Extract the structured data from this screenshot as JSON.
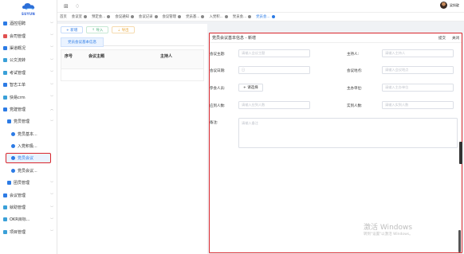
{
  "logo": {
    "text": "SUYUN"
  },
  "sidebar": {
    "items": [
      {
        "label": "酒控招聘",
        "color": "#2c7be5",
        "level": 0
      },
      {
        "label": "会司管理",
        "color": "#e05050",
        "level": 0
      },
      {
        "label": "渠道概况",
        "color": "#2c7be5",
        "level": 0
      },
      {
        "label": "公文流转",
        "color": "#3aa0d8",
        "level": 0
      },
      {
        "label": "考试管理",
        "color": "#3aa0d8",
        "level": 0
      },
      {
        "label": "智志工单",
        "color": "#2c7be5",
        "level": 0
      },
      {
        "label": "快易crm",
        "color": "#3aa0d8",
        "level": 0
      },
      {
        "label": "党建管理",
        "color": "#2c7be5",
        "level": 0
      },
      {
        "label": "党员管理",
        "color": "#2c7be5",
        "level": 1
      },
      {
        "label": "党员基本...",
        "color": "#2c7be5",
        "level": 2,
        "dot": true
      },
      {
        "label": "入党积极...",
        "color": "#2c7be5",
        "level": 2,
        "dot": true
      },
      {
        "label": "党员会议",
        "color": "#2c7be5",
        "level": 2,
        "dot": true,
        "active": true
      },
      {
        "label": "党员会议...",
        "color": "#2c7be5",
        "level": 2,
        "dot": true
      },
      {
        "label": "团员管理",
        "color": "#2c7be5",
        "level": 1
      },
      {
        "label": "会议管理",
        "color": "#2c7be5",
        "level": 0
      },
      {
        "label": "就助管理",
        "color": "#3aa0d8",
        "level": 0
      },
      {
        "label": "OKR目标...",
        "color": "#3aa0d8",
        "level": 0
      },
      {
        "label": "项目管理",
        "color": "#3aa0d8",
        "level": 0
      }
    ]
  },
  "topbar": {
    "username": "梁斜靛"
  },
  "tabs": [
    {
      "label": "首页",
      "active": false
    },
    {
      "label": "会议室",
      "active": false
    },
    {
      "label": "预定会...",
      "active": false
    },
    {
      "label": "会议通知",
      "active": false
    },
    {
      "label": "会议记录",
      "active": false
    },
    {
      "label": "会议管理",
      "active": false
    },
    {
      "label": "党员基...",
      "active": false
    },
    {
      "label": "入党积...",
      "active": false
    },
    {
      "label": "党员会...",
      "active": false
    },
    {
      "label": "党员会...",
      "active": true
    }
  ],
  "list": {
    "add_label": "+ 新增",
    "import_label": "⇡ 导入",
    "export_label": "⇣ 导出",
    "subtab_label": "党员会议基本信息",
    "columns": [
      "序号",
      "会议主题",
      "主持人"
    ]
  },
  "form": {
    "title": "党员会议基本信息 - 新增",
    "submit_label": "提交",
    "close_label": "关闭",
    "fields": {
      "topic_label": "会议主题:",
      "topic_placeholder": "请输入会议主题",
      "host_label": "主持人:",
      "host_placeholder": "请输入主持人",
      "date_label": "会议日期:",
      "date_placeholder": "日",
      "place_label": "会议地点:",
      "place_placeholder": "请输入会议地点",
      "attendees_label": "参会人员:",
      "attendees_button": "+ 请选择",
      "org_label": "主办单位:",
      "org_placeholder": "请输入主办单位",
      "expected_label": "应到人数:",
      "expected_placeholder": "请输入应到人数",
      "actual_label": "实到人数:",
      "actual_placeholder": "请输入实到人数",
      "remark_label": "备注:",
      "remark_placeholder": "请输入备注"
    }
  },
  "watermark": {
    "line1": "激活 Windows",
    "line2": "转到\"设置\"以激活 Windows。"
  }
}
